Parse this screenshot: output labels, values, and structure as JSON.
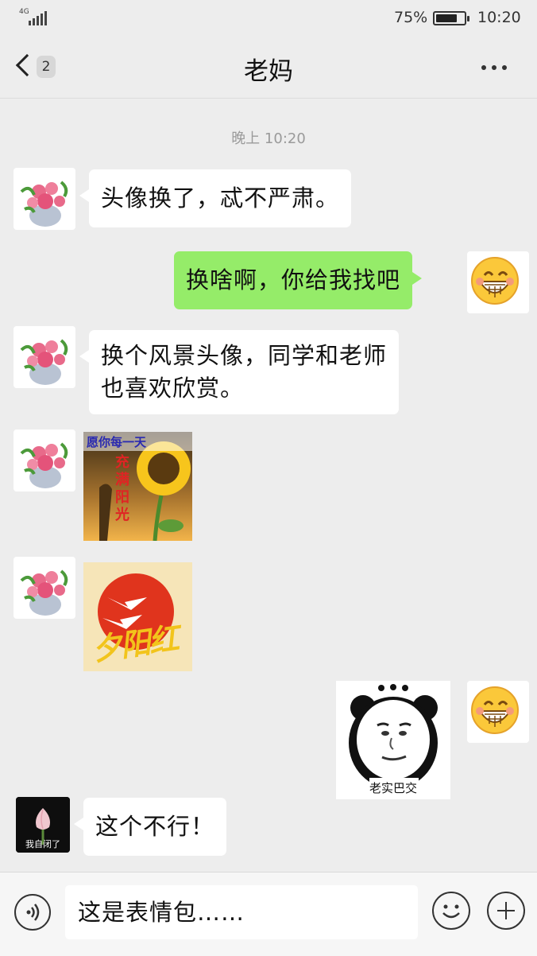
{
  "status_bar": {
    "network": "4G",
    "battery_text": "75%",
    "battery_level": 0.75,
    "time": "10:20"
  },
  "nav": {
    "unread_count": "2",
    "title": "老妈"
  },
  "timestamp": "晚上 10:20",
  "messages": [
    {
      "from": "them",
      "kind": "text",
      "lines": [
        "头像换了，忒不严肃。"
      ]
    },
    {
      "from": "me",
      "kind": "text",
      "lines": [
        "换啥啊，你给我找吧"
      ]
    },
    {
      "from": "them",
      "kind": "text",
      "lines": [
        "换个风景头像，同学和老师",
        "也喜欢欣赏。"
      ]
    },
    {
      "from": "them",
      "kind": "sticker",
      "lines": [
        "愿你每一天",
        "充满阳光"
      ]
    },
    {
      "from": "them",
      "kind": "sticker",
      "lines": [
        "夕阳红"
      ]
    },
    {
      "from": "me",
      "kind": "sticker",
      "lines": [
        "老实巴交"
      ]
    },
    {
      "from": "them",
      "kind": "text",
      "avatar_caption": "我自闭了",
      "lines": [
        "这个不行！"
      ]
    }
  ],
  "input": {
    "value": "这是表情包……"
  },
  "icons": {
    "voice": "voice-icon",
    "emoji": "emoji-icon",
    "plus": "plus-icon",
    "back": "chevron-left-icon",
    "more": "more-icon"
  },
  "colors": {
    "background": "#ededed",
    "bubble_out": "#95ec69",
    "bubble_in": "#ffffff"
  }
}
